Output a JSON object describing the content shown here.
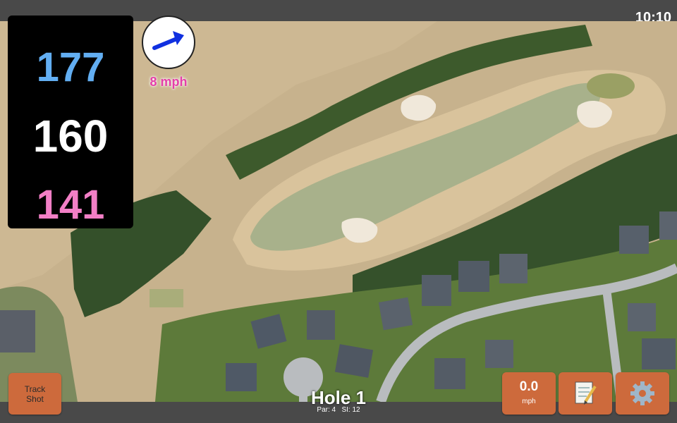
{
  "status_bar": {
    "time": "10:10"
  },
  "distances": {
    "back": "177",
    "middle": "160",
    "front": "141"
  },
  "wind": {
    "speed": "8 mph",
    "icon": "wind-direction-arrow-icon"
  },
  "hole": {
    "title": "Hole 1",
    "par": "Par: 4",
    "stroke_index": "SI: 12"
  },
  "buttons": {
    "track_line1": "Track",
    "track_line2": "Shot",
    "speed_value": "0.0",
    "speed_unit": "mph",
    "notes_icon": "notepad-icon",
    "settings_icon": "gear-icon"
  },
  "colors": {
    "back_distance": "#62aef2",
    "middle_distance": "#ffffff",
    "front_distance": "#f27fc6",
    "button_accent": "#cd6a3c",
    "wind_speed": "#e43fa8"
  }
}
